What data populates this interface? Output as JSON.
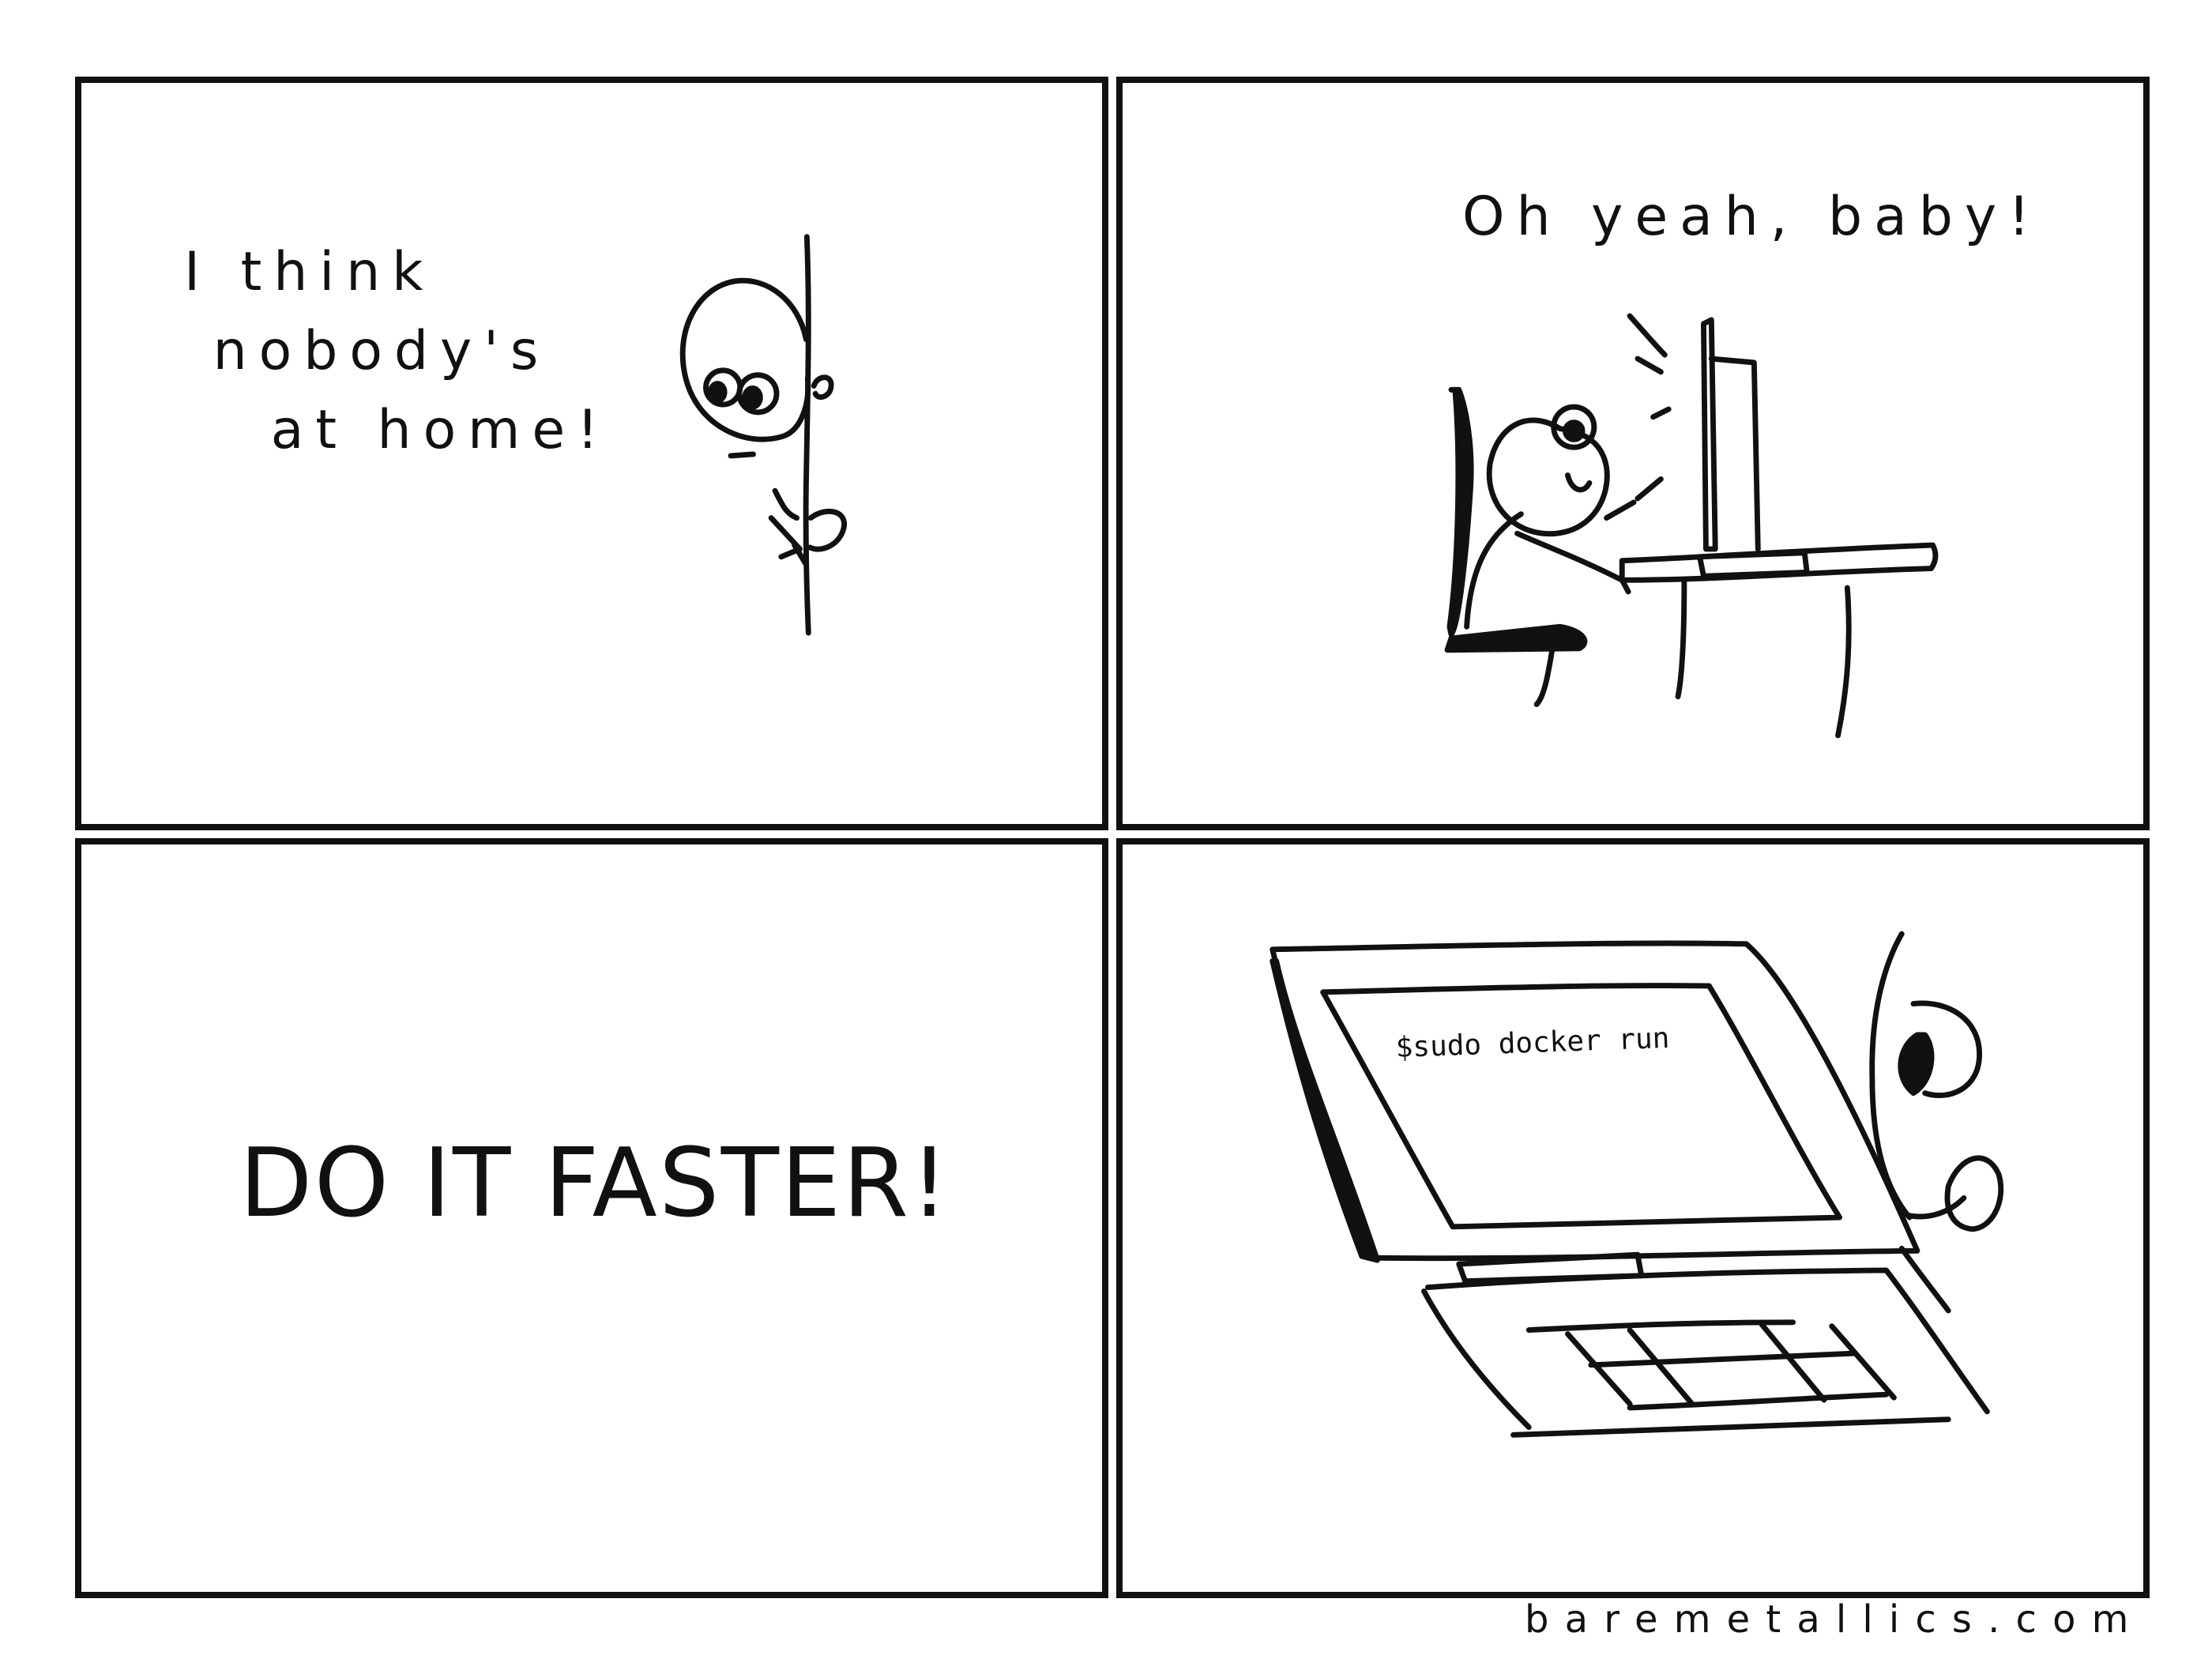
{
  "panels": [
    {
      "id": 1,
      "caption": "I think\n nobody's\n   at home!"
    },
    {
      "id": 2,
      "caption": "Oh yeah, baby!"
    },
    {
      "id": 3,
      "caption": "DO IT FASTER!"
    },
    {
      "id": 4,
      "screen_text": "$sudo docker run"
    }
  ],
  "footer": "baremetallics.com",
  "colors": {
    "ink": "#111111",
    "background": "#ffffff"
  },
  "icons": [
    "stick-figure-peeking",
    "wall",
    "stick-figure-at-computer",
    "office-chair",
    "desk",
    "monitor",
    "laptop",
    "keyboard",
    "face-closeup"
  ]
}
